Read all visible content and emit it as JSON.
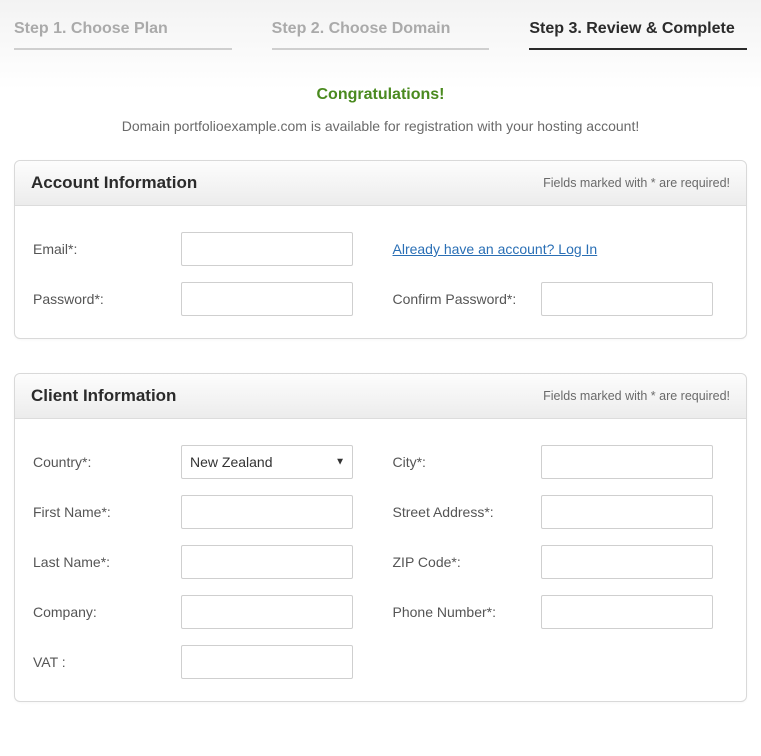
{
  "steps": {
    "s1": "Step 1. Choose Plan",
    "s2": "Step 2. Choose Domain",
    "s3": "Step 3. Review & Complete"
  },
  "banner": {
    "congrats": "Congratulations!",
    "domain_msg": "Domain portfolioexample.com is available for registration with your hosting account!"
  },
  "req_note": "Fields marked with * are required!",
  "account": {
    "title": "Account Information",
    "email_label": "Email*:",
    "email_value": "",
    "password_label": "Password*:",
    "password_value": "",
    "confirm_label": "Confirm Password*:",
    "confirm_value": "",
    "login_link": "Already have an account? Log In"
  },
  "client": {
    "title": "Client Information",
    "country_label": "Country*:",
    "country_value": "New Zealand",
    "firstname_label": "First Name*:",
    "firstname_value": "",
    "lastname_label": "Last Name*:",
    "lastname_value": "",
    "company_label": "Company:",
    "company_value": "",
    "vat_label": "VAT :",
    "vat_value": "",
    "city_label": "City*:",
    "city_value": "",
    "street_label": "Street Address*:",
    "street_value": "",
    "zip_label": "ZIP Code*:",
    "zip_value": "",
    "phone_label": "Phone Number*:",
    "phone_value": ""
  }
}
